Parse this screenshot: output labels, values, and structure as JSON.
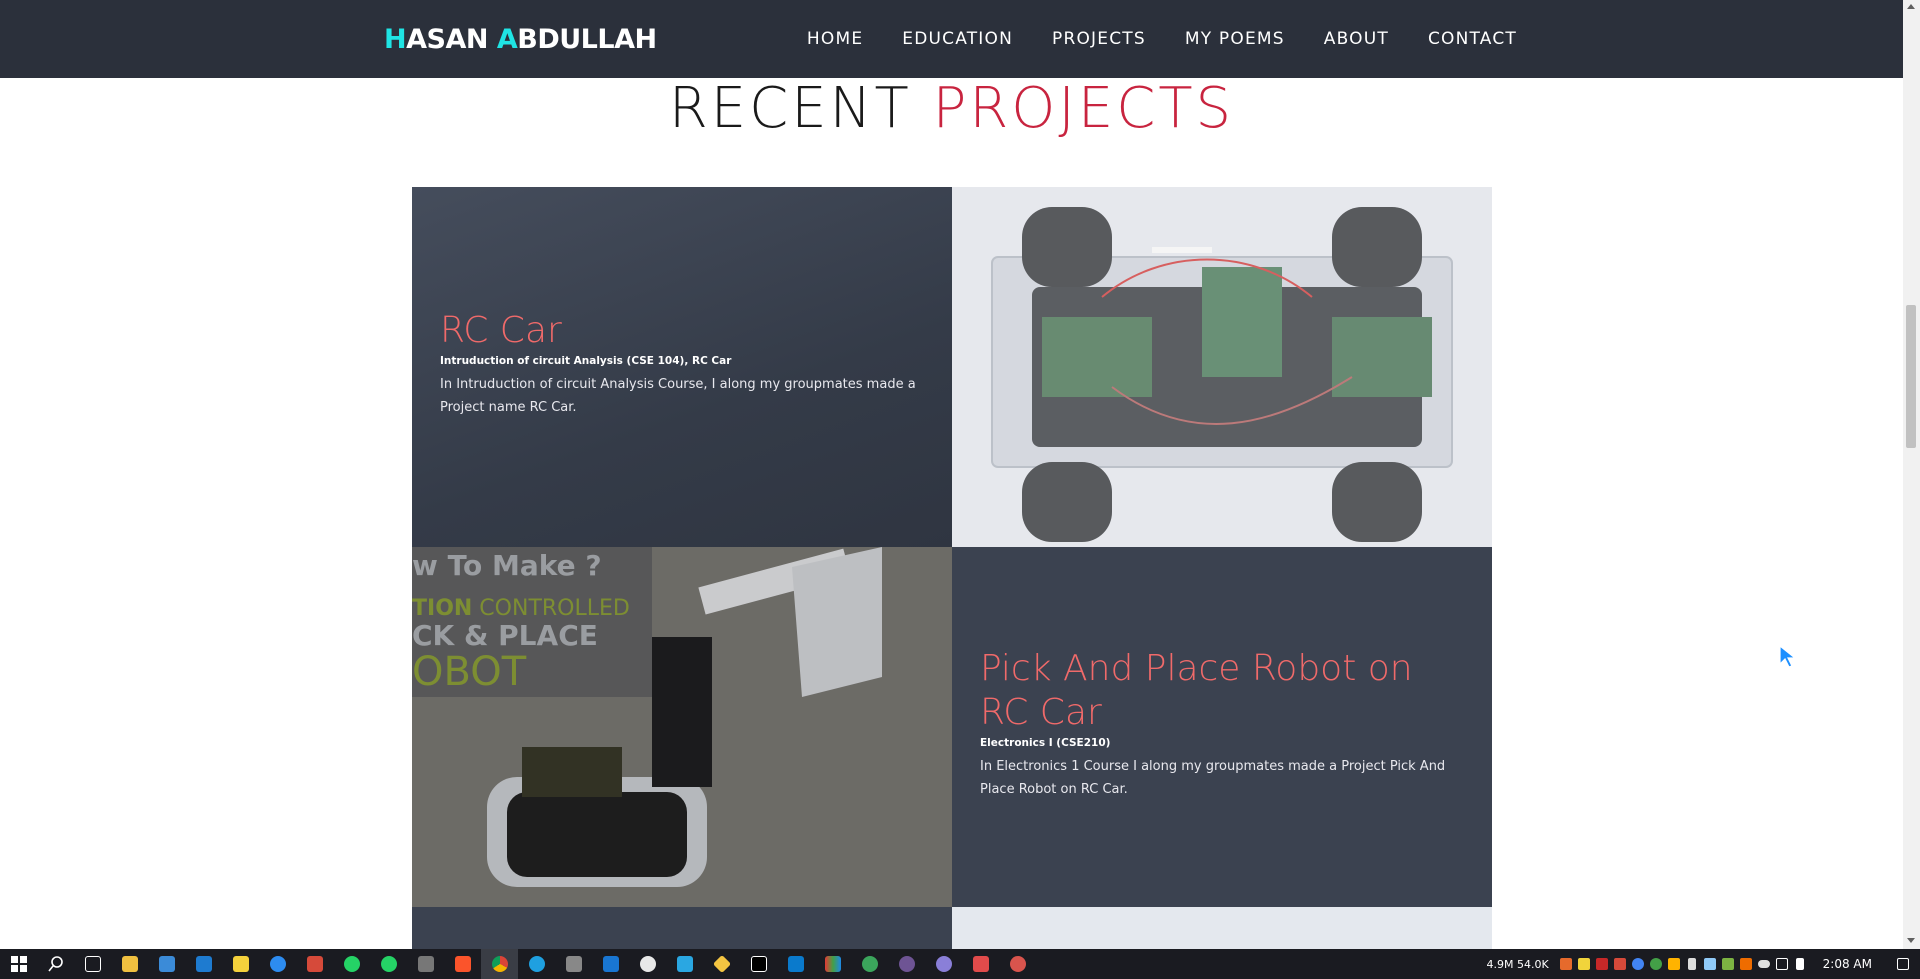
{
  "nav": {
    "brand_first_initial": "H",
    "brand_first_rest": "ASAN ",
    "brand_last_initial": "A",
    "brand_last_rest": "BDULLAH",
    "links": [
      "HOME",
      "EDUCATION",
      "PROJECTS",
      "MY POEMS",
      "ABOUT",
      "CONTACT"
    ]
  },
  "section": {
    "title_part1": "RECENT ",
    "title_part2": "PROJECTS"
  },
  "projects": [
    {
      "title": "RC Car",
      "subtitle": "Intruduction of circuit Analysis (CSE 104), RC Car",
      "description": "In Intruduction of circuit Analysis Course, I along my groupmates made a Project name RC Car."
    },
    {
      "title": "Pick And Place Robot on RC Car",
      "subtitle": "Electronics I (CSE210)",
      "description": "In Electronics 1 Course I along my groupmates made a Project Pick And Place Robot on RC Car.",
      "image_overlay": {
        "line1": "w To Make ?",
        "line2a": "TION",
        "line2b": " CONTROLLED",
        "line3": "CK & PLACE",
        "line4": "OBOT"
      }
    }
  ],
  "taskbar": {
    "net_speed": "4.9M 54.0K",
    "clock": "2:08 AM"
  },
  "colors": {
    "nav_bg": "#2b303b",
    "brand_accent": "#1fe4e4",
    "title_red": "#c8243f",
    "project_title": "#f06a6a",
    "card_bg": "#3b4250"
  }
}
